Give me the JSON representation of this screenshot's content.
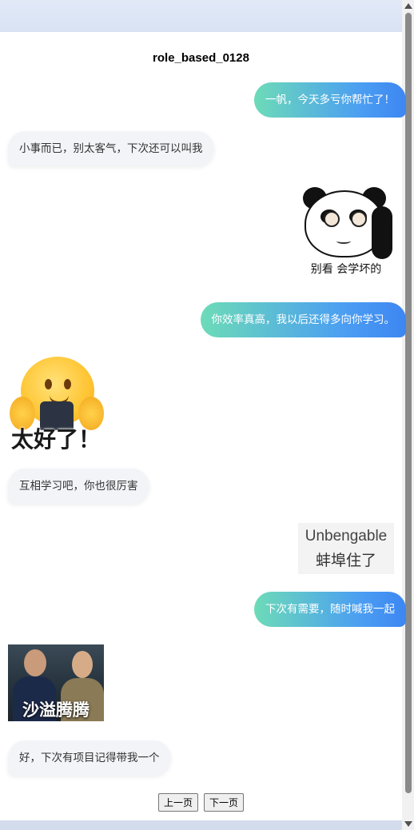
{
  "title": "role_based_0128",
  "messages": {
    "m1": "一帆，今天多亏你帮忙了！",
    "m2": "小事而已，别太客气，下次还可以叫我",
    "m3": "你效率真高，我以后还得多向你学习。",
    "m4": "互相学习吧，你也很厉害",
    "m5": "下次有需要，随时喊我一起",
    "m6": "好，下次有项目记得带我一个"
  },
  "stickers": {
    "panda_caption": "别看 会学坏的",
    "emoji_caption": "太好了！",
    "text_line1": "Unbengable",
    "text_line2": "蚌埠住了",
    "photo_caption": "沙溢腾腾"
  },
  "pager": {
    "prev": "上一页",
    "next": "下一页"
  },
  "colors": {
    "bubble_right_start": "#6ddbb8",
    "bubble_right_end": "#3d86f2",
    "bubble_left": "#f2f4f8"
  }
}
